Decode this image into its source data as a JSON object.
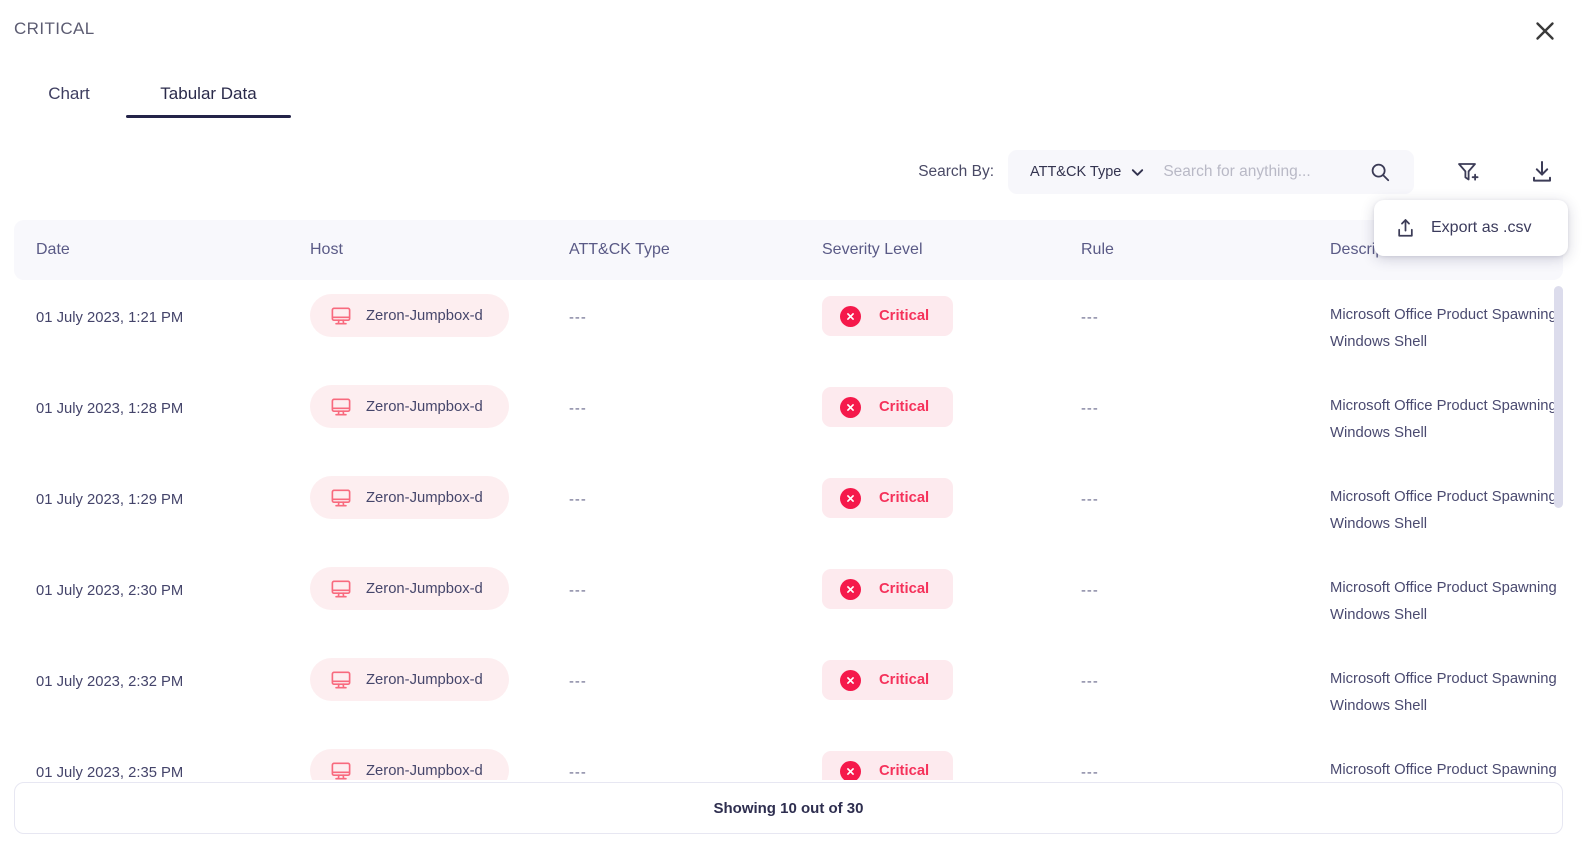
{
  "header": {
    "title": "CRITICAL",
    "close_icon": "close-icon"
  },
  "tabs": [
    {
      "label": "Chart",
      "active": false
    },
    {
      "label": "Tabular Data",
      "active": true
    }
  ],
  "toolbar": {
    "search_by_label": "Search By:",
    "search_field_selected": "ATT&CK Type",
    "search_placeholder": "Search for anything...",
    "search_value": "",
    "search_icon": "search-icon",
    "filter_icon": "filter-add-icon",
    "download_icon": "download-icon"
  },
  "export_menu": {
    "icon": "upload-icon",
    "label": "Export as .csv"
  },
  "table": {
    "columns": [
      "Date",
      "Host",
      "ATT&CK Type",
      "Severity Level",
      "Rule",
      "Description"
    ],
    "empty_value": "---",
    "rows": [
      {
        "date": "01 July 2023, 1:21 PM",
        "host": "Zeron-Jumpbox-d",
        "attack_type": "---",
        "severity": "Critical",
        "rule": "---",
        "description": "Microsoft Office Product Spawning Windows Shell"
      },
      {
        "date": "01 July 2023, 1:28 PM",
        "host": "Zeron-Jumpbox-d",
        "attack_type": "---",
        "severity": "Critical",
        "rule": "---",
        "description": "Microsoft Office Product Spawning Windows Shell"
      },
      {
        "date": "01 July 2023, 1:29 PM",
        "host": "Zeron-Jumpbox-d",
        "attack_type": "---",
        "severity": "Critical",
        "rule": "---",
        "description": "Microsoft Office Product Spawning Windows Shell"
      },
      {
        "date": "01 July 2023, 2:30 PM",
        "host": "Zeron-Jumpbox-d",
        "attack_type": "---",
        "severity": "Critical",
        "rule": "---",
        "description": "Microsoft Office Product Spawning Windows Shell"
      },
      {
        "date": "01 July 2023, 2:32 PM",
        "host": "Zeron-Jumpbox-d",
        "attack_type": "---",
        "severity": "Critical",
        "rule": "---",
        "description": "Microsoft Office Product Spawning Windows Shell"
      },
      {
        "date": "01 July 2023, 2:35 PM",
        "host": "Zeron-Jumpbox-d",
        "attack_type": "---",
        "severity": "Critical",
        "rule": "---",
        "description": "Microsoft Office Product Spawning Windows Shell"
      }
    ]
  },
  "footer": {
    "showing_text": "Showing 10 out of 30"
  },
  "colors": {
    "critical_red": "#f5194b",
    "critical_badge_bg": "#fdeaee",
    "host_badge_bg": "#fdeef0",
    "host_icon": "#f86a7e",
    "header_bg": "#f8f8fc",
    "tab_underline": "#232348",
    "text_primary": "#3e3e60",
    "text_muted": "#5a5a86",
    "scrollbar": "#dcdcec"
  }
}
